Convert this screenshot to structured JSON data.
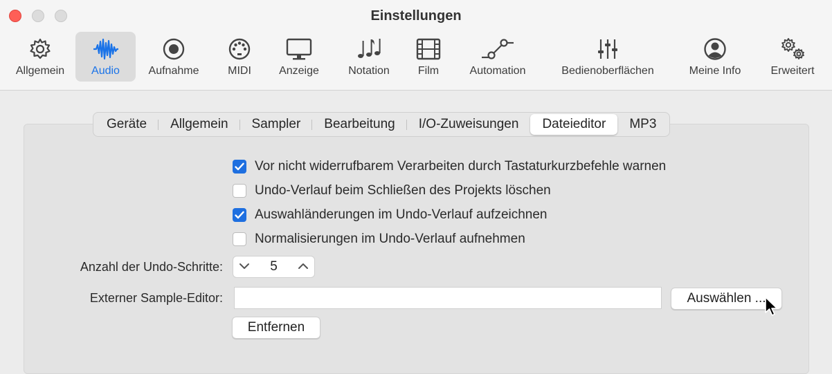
{
  "window": {
    "title": "Einstellungen"
  },
  "toolbar": {
    "items": [
      {
        "label": "Allgemein",
        "icon": "gear-icon"
      },
      {
        "label": "Audio",
        "icon": "waveform-icon",
        "selected": true
      },
      {
        "label": "Aufnahme",
        "icon": "record-icon"
      },
      {
        "label": "MIDI",
        "icon": "midi-icon"
      },
      {
        "label": "Anzeige",
        "icon": "monitor-icon"
      },
      {
        "label": "Notation",
        "icon": "notes-icon"
      },
      {
        "label": "Film",
        "icon": "film-icon"
      },
      {
        "label": "Automation",
        "icon": "automation-icon"
      },
      {
        "label": "Bedienoberflächen",
        "icon": "sliders-icon"
      },
      {
        "label": "Meine Info",
        "icon": "person-icon"
      },
      {
        "label": "Erweitert",
        "icon": "gears-icon"
      }
    ]
  },
  "tabs": [
    {
      "label": "Geräte"
    },
    {
      "label": "Allgemein"
    },
    {
      "label": "Sampler"
    },
    {
      "label": "Bearbeitung"
    },
    {
      "label": "I/O-Zuweisungen"
    },
    {
      "label": "Dateieditor",
      "selected": true
    },
    {
      "label": "MP3"
    }
  ],
  "options": [
    {
      "label": "Vor nicht widerrufbarem Verarbeiten durch Tastaturkurzbefehle warnen",
      "checked": true
    },
    {
      "label": "Undo-Verlauf beim Schließen des Projekts löschen",
      "checked": false
    },
    {
      "label": "Auswahländerungen im Undo-Verlauf aufzeichnen",
      "checked": true
    },
    {
      "label": "Normalisierungen im Undo-Verlauf aufnehmen",
      "checked": false
    }
  ],
  "undo_steps": {
    "label": "Anzahl der Undo-Schritte:",
    "value": "5"
  },
  "external_editor": {
    "label": "Externer Sample-Editor:",
    "value": "",
    "choose_label": "Auswählen ...",
    "remove_label": "Entfernen"
  },
  "colors": {
    "accent": "#1e6fe0",
    "close": "#fe5f57"
  }
}
